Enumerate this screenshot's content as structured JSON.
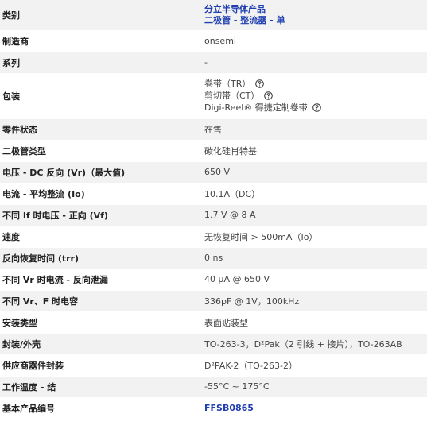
{
  "rows": [
    {
      "label": "类别",
      "values": [
        "分立半导体产品",
        "二极管 - 整流器 - 单"
      ],
      "link": true
    },
    {
      "label": "制造商",
      "value": "onsemi"
    },
    {
      "label": "系列",
      "value": "-"
    },
    {
      "label": "包装",
      "packaging": [
        "卷带（TR）",
        "剪切带（CT）",
        "Digi-Reel® 得捷定制卷带"
      ]
    },
    {
      "label": "零件状态",
      "value": "在售"
    },
    {
      "label": "二极管类型",
      "value": "碳化硅肖特基"
    },
    {
      "label": "电压 - DC 反向 (Vr)（最大值)",
      "value": "650 V"
    },
    {
      "label": "电流 - 平均整流 (Io)",
      "value": "10.1A（DC）"
    },
    {
      "label": "不同 If 时电压 - 正向 (Vf)",
      "value": "1.7 V @ 8 A"
    },
    {
      "label": "速度",
      "value": "无恢复时间 > 500mA（Io）"
    },
    {
      "label": "反向恢复时间 (trr)",
      "value": "0 ns"
    },
    {
      "label": "不同 Vr 时电流 - 反向泄漏",
      "value": "40 µA @ 650 V"
    },
    {
      "label": "不同 Vr、F 时电容",
      "value": "336pF @ 1V，100kHz"
    },
    {
      "label": "安装类型",
      "value": "表面贴装型"
    },
    {
      "label": "封装/外壳",
      "value": "TO-263-3，D²Pak（2 引线 + 接片），TO-263AB"
    },
    {
      "label": "供应商器件封装",
      "value": "D²PAK-2（TO-263-2）"
    },
    {
      "label": "工作温度 - 结",
      "value": "-55°C ~ 175°C"
    },
    {
      "label": "基本产品编号",
      "value": "FFSB0865",
      "link": true
    }
  ],
  "colors": {
    "link": "#1f3fb0",
    "row_alt": "#f2f2f2",
    "text": "#333333"
  },
  "icons": {
    "help": "question-circle-icon"
  }
}
